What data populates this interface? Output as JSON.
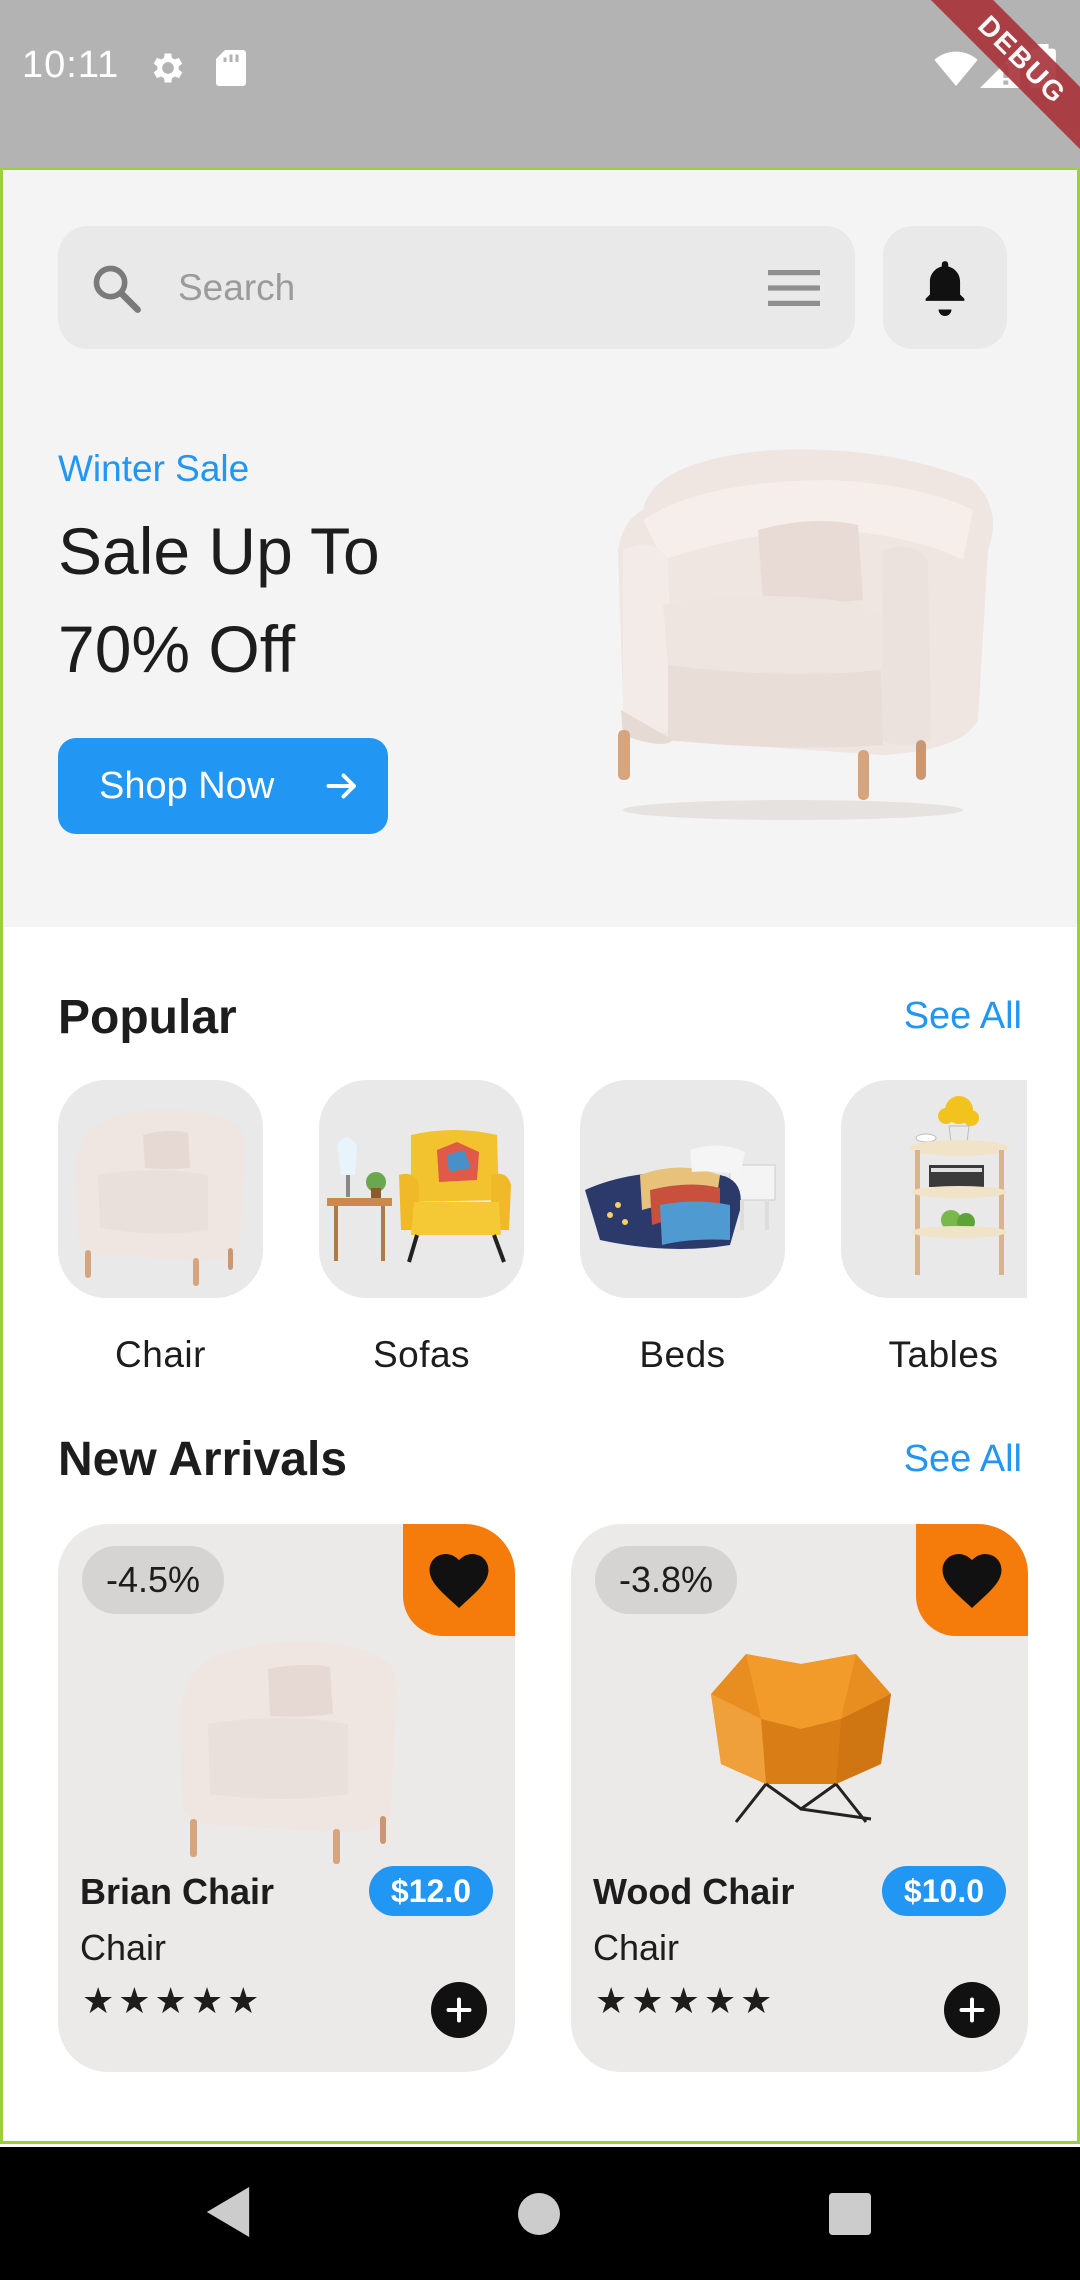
{
  "status_bar": {
    "time": "10:11",
    "debug_label": "DEBUG",
    "icons": [
      "gear-icon",
      "sd-card-icon",
      "wifi-icon",
      "signal-icon",
      "battery-icon"
    ]
  },
  "search": {
    "placeholder": "Search",
    "value": ""
  },
  "promo": {
    "tag": "Winter Sale",
    "title": "Sale Up To 70% Off",
    "button_label": "Shop Now"
  },
  "popular": {
    "title": "Popular",
    "see_all": "See All",
    "categories": [
      {
        "label": "Chair"
      },
      {
        "label": "Sofas"
      },
      {
        "label": "Beds"
      },
      {
        "label": "Tables"
      }
    ]
  },
  "new_arrivals": {
    "title": "New Arrivals",
    "see_all": "See All",
    "products": [
      {
        "name": "Brian Chair",
        "subtitle": "Chair",
        "discount": "-4.5%",
        "price": "$12.0",
        "rating": 5,
        "stars": "★★★★★"
      },
      {
        "name": "Wood Chair",
        "subtitle": "Chair",
        "discount": "-3.8%",
        "price": "$10.0",
        "rating": 5,
        "stars": "★★★★★"
      }
    ]
  },
  "colors": {
    "accent": "#2196f3",
    "favorite": "#f57c0a",
    "card_bg": "#ece9e9",
    "text": "#1d1d1d"
  }
}
